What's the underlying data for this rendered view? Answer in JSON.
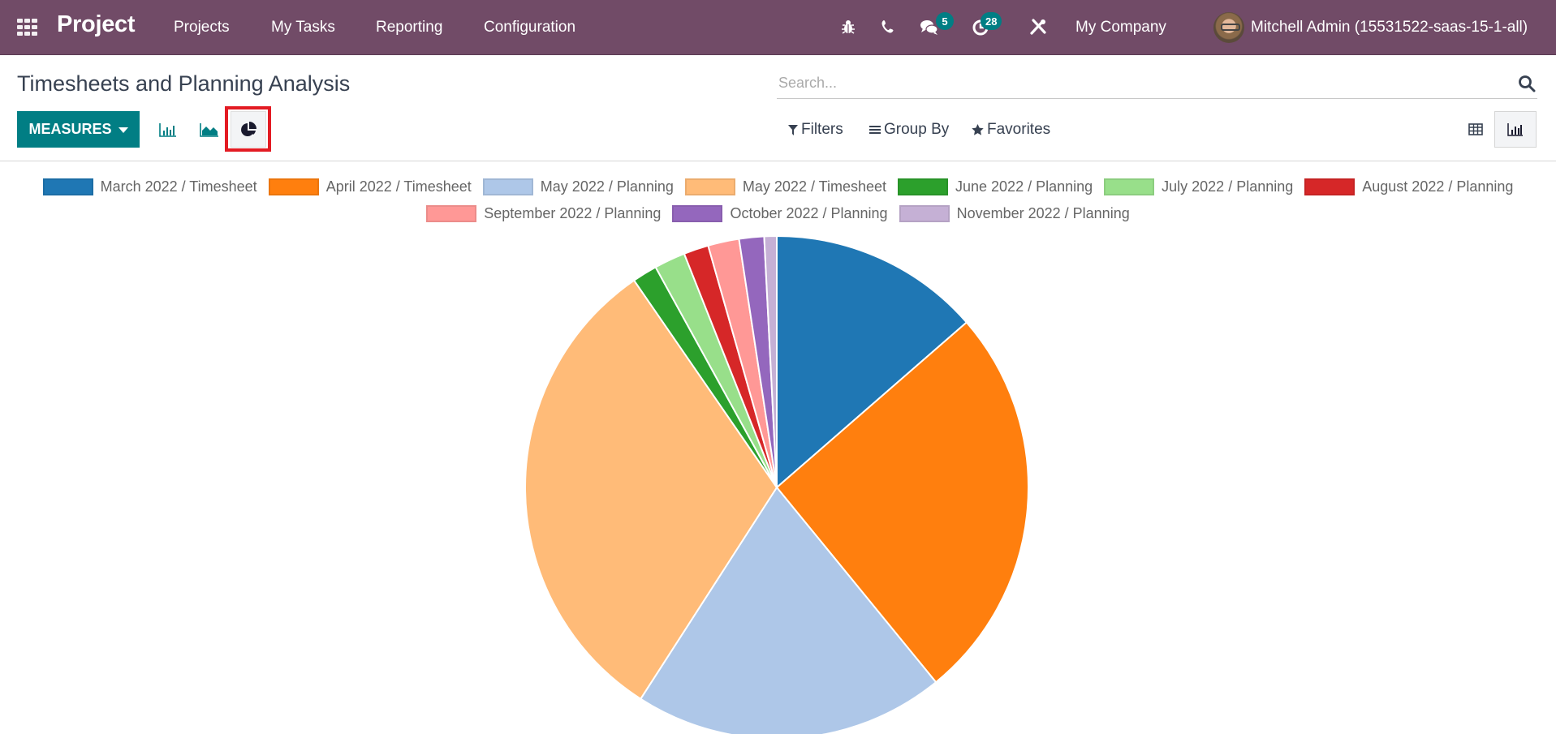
{
  "navbar": {
    "app_name": "Project",
    "menu": [
      "Projects",
      "My Tasks",
      "Reporting",
      "Configuration"
    ],
    "icons": [
      "bug-icon",
      "phone-icon",
      "chat-icon",
      "activity-clock-icon",
      "tools-icon"
    ],
    "messages_count": "5",
    "activities_count": "28",
    "company": "My Company",
    "user": "Mitchell Admin (15531522-saas-15-1-all)"
  },
  "control_panel": {
    "title": "Timesheets and Planning Analysis",
    "search_placeholder": "Search...",
    "measures_label": "MEASURES",
    "chart_types": [
      "bar-chart",
      "line-chart",
      "pie-chart"
    ],
    "active_chart_type": "pie-chart",
    "filters_label": "Filters",
    "group_by_label": "Group By",
    "favorites_label": "Favorites",
    "views": [
      "pivot",
      "graph"
    ],
    "active_view": "graph"
  },
  "chart_data": {
    "type": "pie",
    "title": "",
    "unit": "percent of total (estimated from slice angles)",
    "legend_position": "top",
    "start_angle": "12 o'clock, clockwise",
    "categories": [
      "March 2022 / Timesheet",
      "April 2022 / Timesheet",
      "May 2022 / Planning",
      "May 2022 / Timesheet",
      "June 2022 / Planning",
      "July 2022 / Planning",
      "August 2022 / Planning",
      "September 2022 / Planning",
      "October 2022 / Planning",
      "November 2022 / Planning"
    ],
    "values": [
      13.6,
      25.5,
      20.0,
      31.3,
      1.6,
      2.0,
      1.6,
      2.0,
      1.6,
      0.8
    ],
    "colors": [
      "#1f77b4",
      "#ff7f0e",
      "#aec7e8",
      "#ffbb78",
      "#2ca02c",
      "#98df8a",
      "#d62728",
      "#ff9896",
      "#9467bd",
      "#c5b0d5"
    ]
  }
}
